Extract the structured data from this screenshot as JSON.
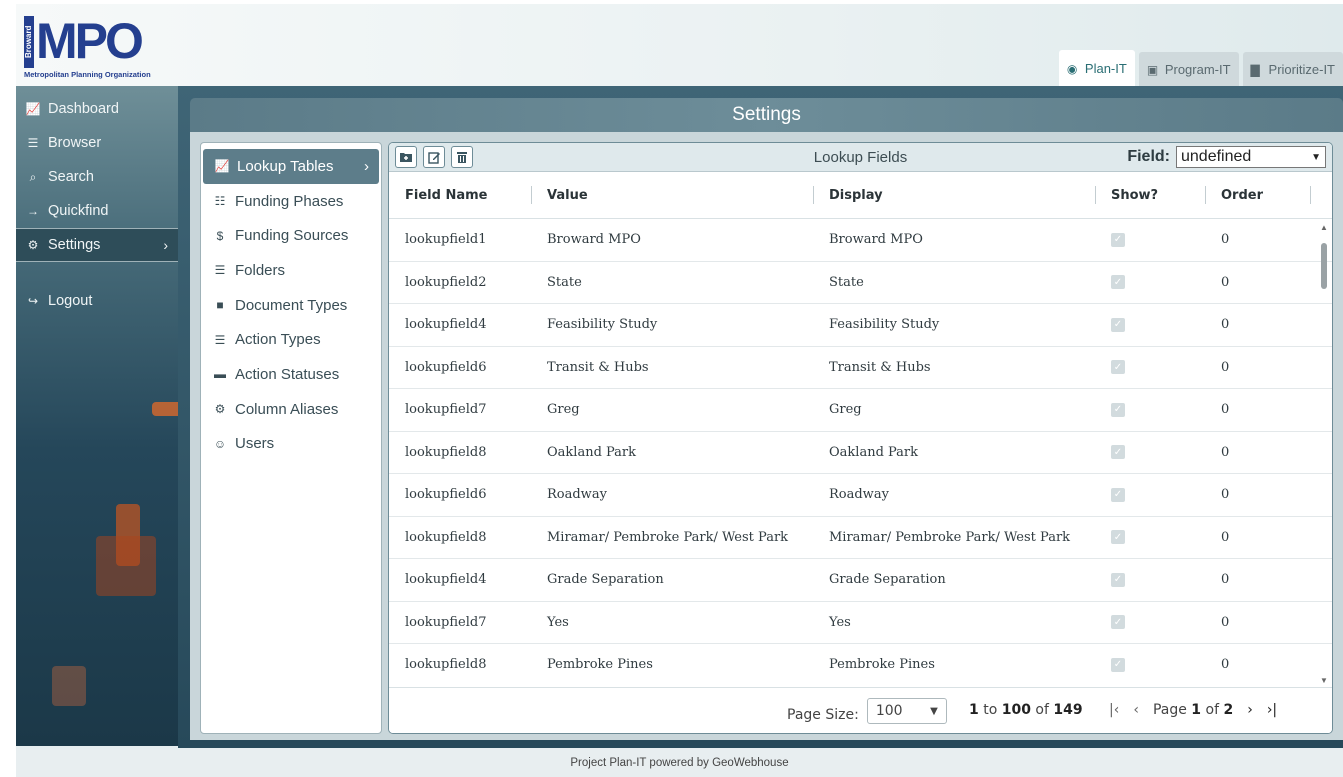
{
  "logo": {
    "vertical_text": "Broward",
    "word": "MPO",
    "subtitle": "Metropolitan Planning Organization"
  },
  "app_tabs": [
    {
      "label": "Plan-IT",
      "icon": "binoculars-icon",
      "active": true
    },
    {
      "label": "Program-IT",
      "icon": "money-icon",
      "active": false
    },
    {
      "label": "Prioritize-IT",
      "icon": "podium-icon",
      "active": false
    }
  ],
  "nav": {
    "items": [
      {
        "label": "Dashboard",
        "icon": "chart-line-icon"
      },
      {
        "label": "Browser",
        "icon": "folder-tree-icon"
      },
      {
        "label": "Search",
        "icon": "search-icon"
      },
      {
        "label": "Quickfind",
        "icon": "arrow-right-icon"
      },
      {
        "label": "Settings",
        "icon": "gear-icon"
      },
      {
        "label": "Logout",
        "icon": "logout-icon"
      }
    ]
  },
  "settings": {
    "title": "Settings",
    "menu": [
      {
        "label": "Lookup Tables",
        "icon": "chart-line-icon"
      },
      {
        "label": "Funding Phases",
        "icon": "sitemap-icon"
      },
      {
        "label": "Funding Sources",
        "icon": "hand-dollar-icon"
      },
      {
        "label": "Folders",
        "icon": "folder-tree-icon"
      },
      {
        "label": "Document Types",
        "icon": "file-icon"
      },
      {
        "label": "Action Types",
        "icon": "list-icon"
      },
      {
        "label": "Action Statuses",
        "icon": "server-icon"
      },
      {
        "label": "Column Aliases",
        "icon": "gear-icon"
      },
      {
        "label": "Users",
        "icon": "users-icon"
      }
    ]
  },
  "grid": {
    "title": "Lookup Fields",
    "field_label": "Field:",
    "field_value": "undefined",
    "columns": [
      "Field Name",
      "Value",
      "Display",
      "Show?",
      "Order"
    ],
    "rows": [
      [
        "lookupfield1",
        "Broward MPO",
        "Broward MPO",
        "0"
      ],
      [
        "lookupfield2",
        "State",
        "State",
        "0"
      ],
      [
        "lookupfield4",
        "Feasibility Study",
        "Feasibility Study",
        "0"
      ],
      [
        "lookupfield6",
        "Transit & Hubs",
        "Transit & Hubs",
        "0"
      ],
      [
        "lookupfield7",
        "Greg",
        "Greg",
        "0"
      ],
      [
        "lookupfield8",
        "Oakland Park",
        "Oakland Park",
        "0"
      ],
      [
        "lookupfield6",
        "Roadway",
        "Roadway",
        "0"
      ],
      [
        "lookupfield8",
        "Miramar/ Pembroke Park/ West Park",
        "Miramar/ Pembroke Park/ West Park",
        "0"
      ],
      [
        "lookupfield4",
        "Grade Separation",
        "Grade Separation",
        "0"
      ],
      [
        "lookupfield7",
        "Yes",
        "Yes",
        "0"
      ],
      [
        "lookupfield8",
        "Pembroke Pines",
        "Pembroke Pines",
        "0"
      ]
    ],
    "pager": {
      "page_size_label": "Page Size:",
      "page_size": "100",
      "range_from": "1",
      "range_to": "100",
      "total": "149",
      "to_word": "to",
      "of_word": "of",
      "page_word": "Page",
      "page": "1",
      "pages": "2"
    }
  },
  "footer": "Project Plan-IT powered by GeoWebhouse"
}
